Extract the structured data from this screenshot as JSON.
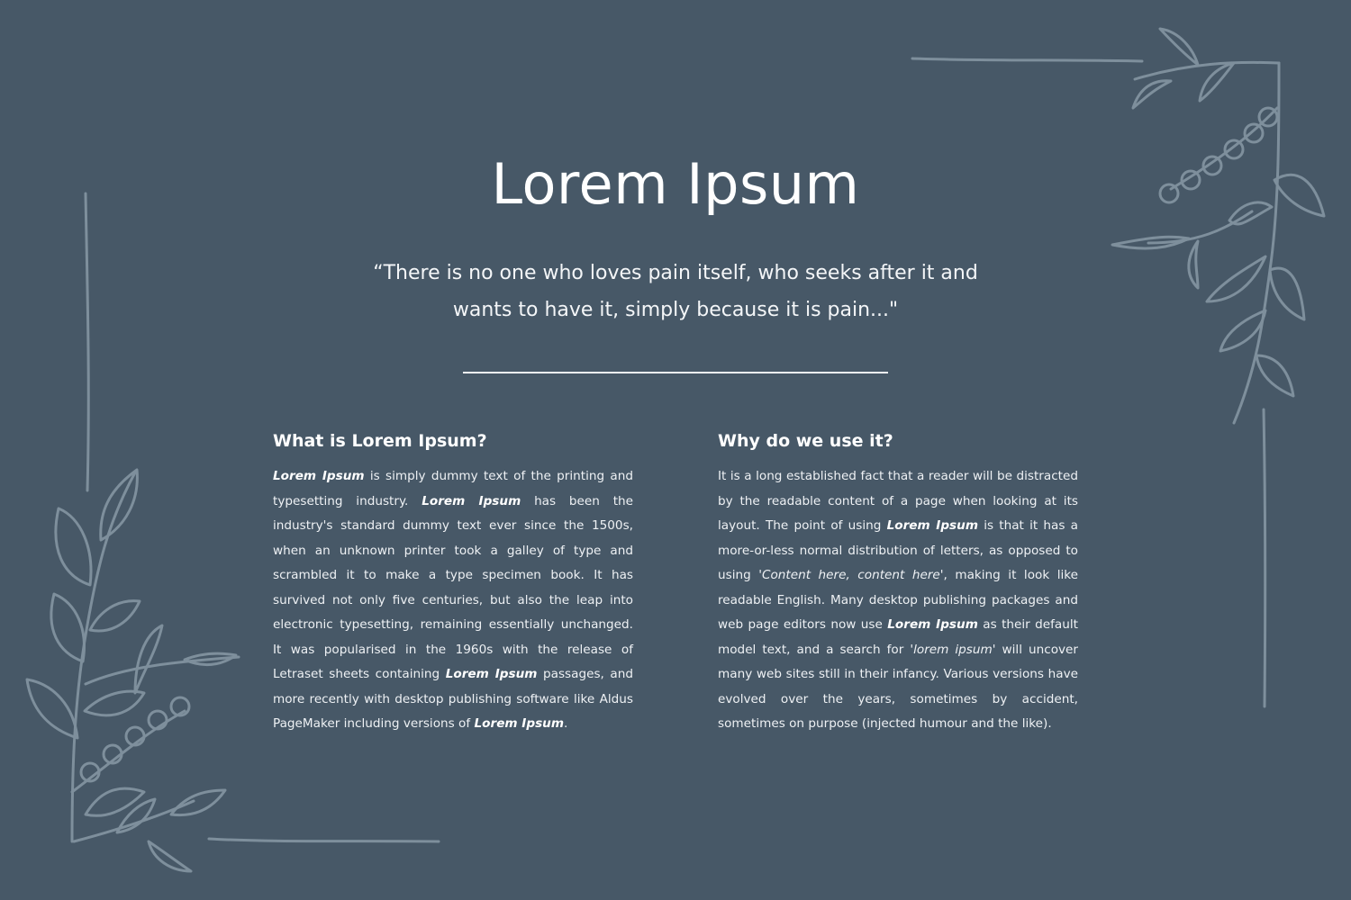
{
  "title": "Lorem Ipsum",
  "quote": {
    "line1": "“There is no one who loves pain itself, who seeks after it and",
    "line2": "wants to have it, simply because it is pain...\""
  },
  "left_column": {
    "heading": "What is Lorem Ipsum?",
    "p1_b1": "Lorem Ipsum",
    "p1_t1": " is simply dummy text of the printing and typesetting industry. ",
    "p1_b2": "Lorem Ipsum",
    "p1_t2": " has been the industry's standard dummy text ever since the 1500s, when an unknown printer took a galley of type and scrambled it to make a type specimen book. It has survived not only five centuries, but also the leap into electronic typesetting, remaining essentially unchanged. It was popularised in the 1960s with the release of Letraset sheets containing ",
    "p1_b3": "Lorem Ipsum",
    "p1_t3": " passages, and more recently with desktop publishing software like Aldus PageMaker including versions of ",
    "p1_b4": "Lorem Ipsum",
    "p1_t4": "."
  },
  "right_column": {
    "heading": "Why do we use it?",
    "p2_t1": "It is a long established fact that a reader will be distracted by the readable content of a page when looking at its layout. The point of using ",
    "p2_b1": "Lorem Ipsum",
    "p2_t2": " is that it has a more-or-less normal distribution of letters, as opposed to using ",
    "p2_i1": "'Content here, content here'",
    "p2_t3": ", making it look like readable English. Many desktop publishing packages and web page editors now use ",
    "p2_b2": "Lorem Ipsum",
    "p2_t4": " as their default model text, and a search for ",
    "p2_i2": "'lorem ipsum'",
    "p2_t5": " will uncover many web sites still in their infancy. Various versions have evolved over the years, sometimes by accident, sometimes on purpose (injected humour and the like)."
  },
  "colors": {
    "background": "#475867",
    "text": "#ffffff",
    "decor_stroke": "#7e8f9c"
  },
  "decor": {
    "bottom_left": "leafy-branch-illustration",
    "top_right": "leafy-branch-illustration"
  }
}
